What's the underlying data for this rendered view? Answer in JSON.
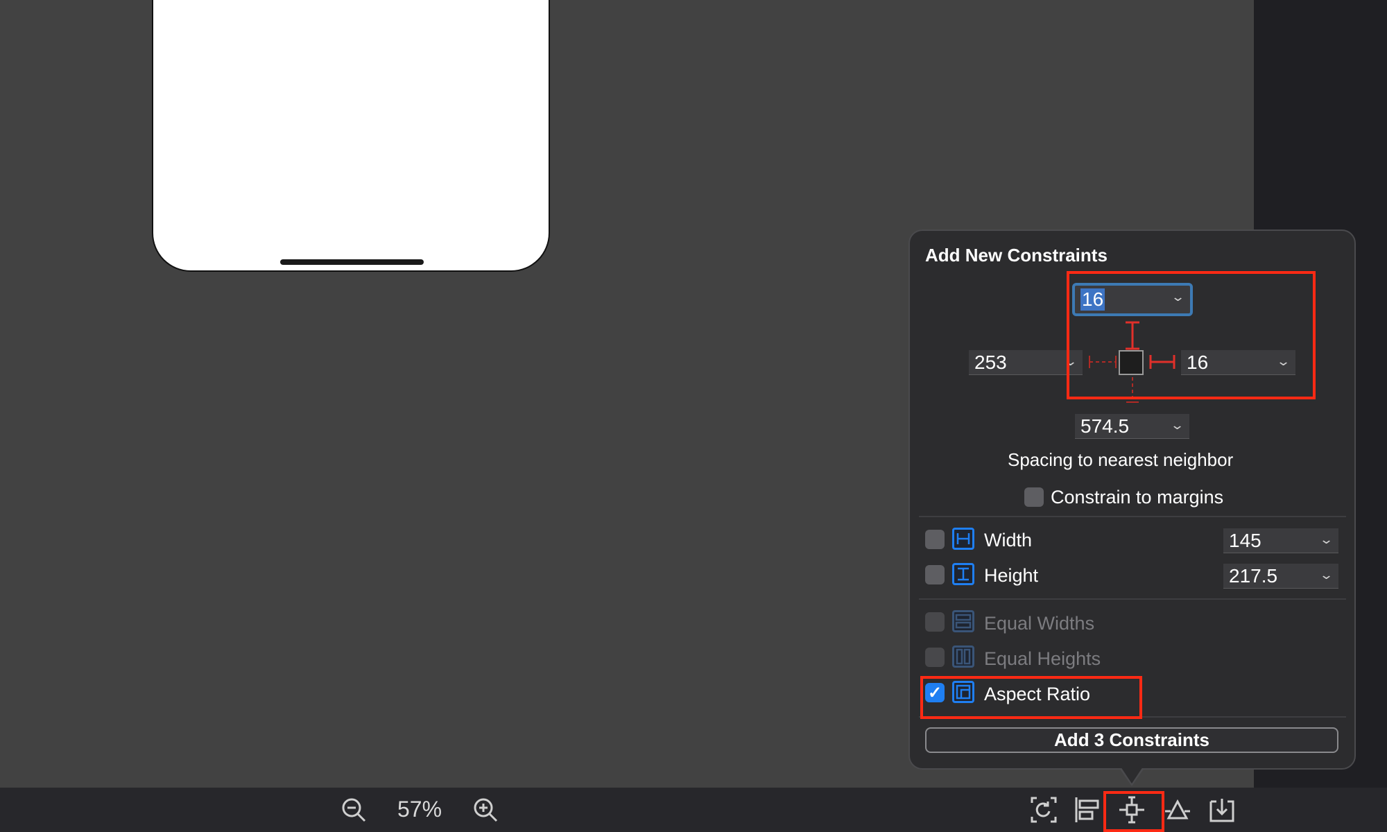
{
  "popover": {
    "title": "Add New Constraints",
    "spacing": {
      "top": "16",
      "left": "253",
      "right": "16",
      "bottom": "574.5"
    },
    "spacing_caption": "Spacing to nearest neighbor",
    "constrain_margins": {
      "label": "Constrain to margins",
      "checked": false
    },
    "width": {
      "label": "Width",
      "value": "145",
      "checked": false
    },
    "height": {
      "label": "Height",
      "value": "217.5",
      "checked": false
    },
    "equal_widths": {
      "label": "Equal Widths",
      "checked": false,
      "enabled": false
    },
    "equal_heights": {
      "label": "Equal Heights",
      "checked": false,
      "enabled": false
    },
    "aspect_ratio": {
      "label": "Aspect Ratio",
      "checked": true
    },
    "add_button": "Add 3 Constraints"
  },
  "bottom_bar": {
    "zoom_level": "57%",
    "icons": [
      "zoom-out-icon",
      "zoom-in-icon",
      "update-frames-icon",
      "align-icon",
      "add-constraints-icon",
      "resolve-issues-icon",
      "embed-in-icon"
    ]
  },
  "colors": {
    "accent": "#1f7ff2",
    "highlight": "#ff2a14",
    "constraint": "#e0302a"
  }
}
